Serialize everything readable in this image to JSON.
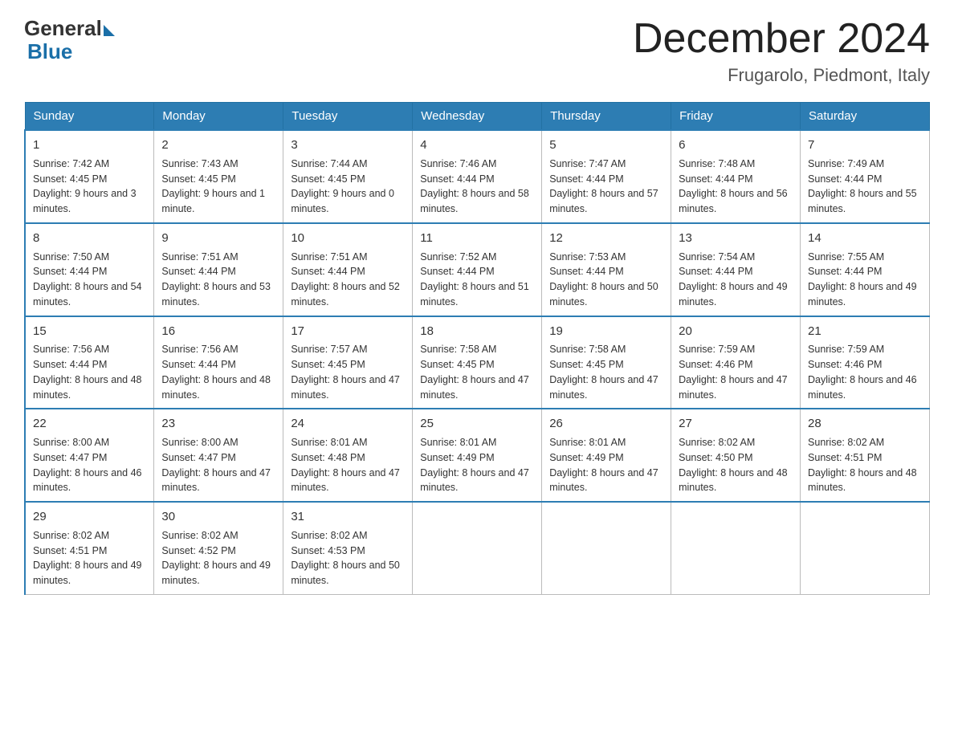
{
  "header": {
    "logo_general": "General",
    "logo_blue": "Blue",
    "month_title": "December 2024",
    "location": "Frugarolo, Piedmont, Italy"
  },
  "days_of_week": [
    "Sunday",
    "Monday",
    "Tuesday",
    "Wednesday",
    "Thursday",
    "Friday",
    "Saturday"
  ],
  "weeks": [
    [
      {
        "day": "1",
        "sunrise": "7:42 AM",
        "sunset": "4:45 PM",
        "daylight": "9 hours and 3 minutes."
      },
      {
        "day": "2",
        "sunrise": "7:43 AM",
        "sunset": "4:45 PM",
        "daylight": "9 hours and 1 minute."
      },
      {
        "day": "3",
        "sunrise": "7:44 AM",
        "sunset": "4:45 PM",
        "daylight": "9 hours and 0 minutes."
      },
      {
        "day": "4",
        "sunrise": "7:46 AM",
        "sunset": "4:44 PM",
        "daylight": "8 hours and 58 minutes."
      },
      {
        "day": "5",
        "sunrise": "7:47 AM",
        "sunset": "4:44 PM",
        "daylight": "8 hours and 57 minutes."
      },
      {
        "day": "6",
        "sunrise": "7:48 AM",
        "sunset": "4:44 PM",
        "daylight": "8 hours and 56 minutes."
      },
      {
        "day": "7",
        "sunrise": "7:49 AM",
        "sunset": "4:44 PM",
        "daylight": "8 hours and 55 minutes."
      }
    ],
    [
      {
        "day": "8",
        "sunrise": "7:50 AM",
        "sunset": "4:44 PM",
        "daylight": "8 hours and 54 minutes."
      },
      {
        "day": "9",
        "sunrise": "7:51 AM",
        "sunset": "4:44 PM",
        "daylight": "8 hours and 53 minutes."
      },
      {
        "day": "10",
        "sunrise": "7:51 AM",
        "sunset": "4:44 PM",
        "daylight": "8 hours and 52 minutes."
      },
      {
        "day": "11",
        "sunrise": "7:52 AM",
        "sunset": "4:44 PM",
        "daylight": "8 hours and 51 minutes."
      },
      {
        "day": "12",
        "sunrise": "7:53 AM",
        "sunset": "4:44 PM",
        "daylight": "8 hours and 50 minutes."
      },
      {
        "day": "13",
        "sunrise": "7:54 AM",
        "sunset": "4:44 PM",
        "daylight": "8 hours and 49 minutes."
      },
      {
        "day": "14",
        "sunrise": "7:55 AM",
        "sunset": "4:44 PM",
        "daylight": "8 hours and 49 minutes."
      }
    ],
    [
      {
        "day": "15",
        "sunrise": "7:56 AM",
        "sunset": "4:44 PM",
        "daylight": "8 hours and 48 minutes."
      },
      {
        "day": "16",
        "sunrise": "7:56 AM",
        "sunset": "4:44 PM",
        "daylight": "8 hours and 48 minutes."
      },
      {
        "day": "17",
        "sunrise": "7:57 AM",
        "sunset": "4:45 PM",
        "daylight": "8 hours and 47 minutes."
      },
      {
        "day": "18",
        "sunrise": "7:58 AM",
        "sunset": "4:45 PM",
        "daylight": "8 hours and 47 minutes."
      },
      {
        "day": "19",
        "sunrise": "7:58 AM",
        "sunset": "4:45 PM",
        "daylight": "8 hours and 47 minutes."
      },
      {
        "day": "20",
        "sunrise": "7:59 AM",
        "sunset": "4:46 PM",
        "daylight": "8 hours and 47 minutes."
      },
      {
        "day": "21",
        "sunrise": "7:59 AM",
        "sunset": "4:46 PM",
        "daylight": "8 hours and 46 minutes."
      }
    ],
    [
      {
        "day": "22",
        "sunrise": "8:00 AM",
        "sunset": "4:47 PM",
        "daylight": "8 hours and 46 minutes."
      },
      {
        "day": "23",
        "sunrise": "8:00 AM",
        "sunset": "4:47 PM",
        "daylight": "8 hours and 47 minutes."
      },
      {
        "day": "24",
        "sunrise": "8:01 AM",
        "sunset": "4:48 PM",
        "daylight": "8 hours and 47 minutes."
      },
      {
        "day": "25",
        "sunrise": "8:01 AM",
        "sunset": "4:49 PM",
        "daylight": "8 hours and 47 minutes."
      },
      {
        "day": "26",
        "sunrise": "8:01 AM",
        "sunset": "4:49 PM",
        "daylight": "8 hours and 47 minutes."
      },
      {
        "day": "27",
        "sunrise": "8:02 AM",
        "sunset": "4:50 PM",
        "daylight": "8 hours and 48 minutes."
      },
      {
        "day": "28",
        "sunrise": "8:02 AM",
        "sunset": "4:51 PM",
        "daylight": "8 hours and 48 minutes."
      }
    ],
    [
      {
        "day": "29",
        "sunrise": "8:02 AM",
        "sunset": "4:51 PM",
        "daylight": "8 hours and 49 minutes."
      },
      {
        "day": "30",
        "sunrise": "8:02 AM",
        "sunset": "4:52 PM",
        "daylight": "8 hours and 49 minutes."
      },
      {
        "day": "31",
        "sunrise": "8:02 AM",
        "sunset": "4:53 PM",
        "daylight": "8 hours and 50 minutes."
      },
      null,
      null,
      null,
      null
    ]
  ],
  "labels": {
    "sunrise": "Sunrise:",
    "sunset": "Sunset:",
    "daylight": "Daylight:"
  }
}
